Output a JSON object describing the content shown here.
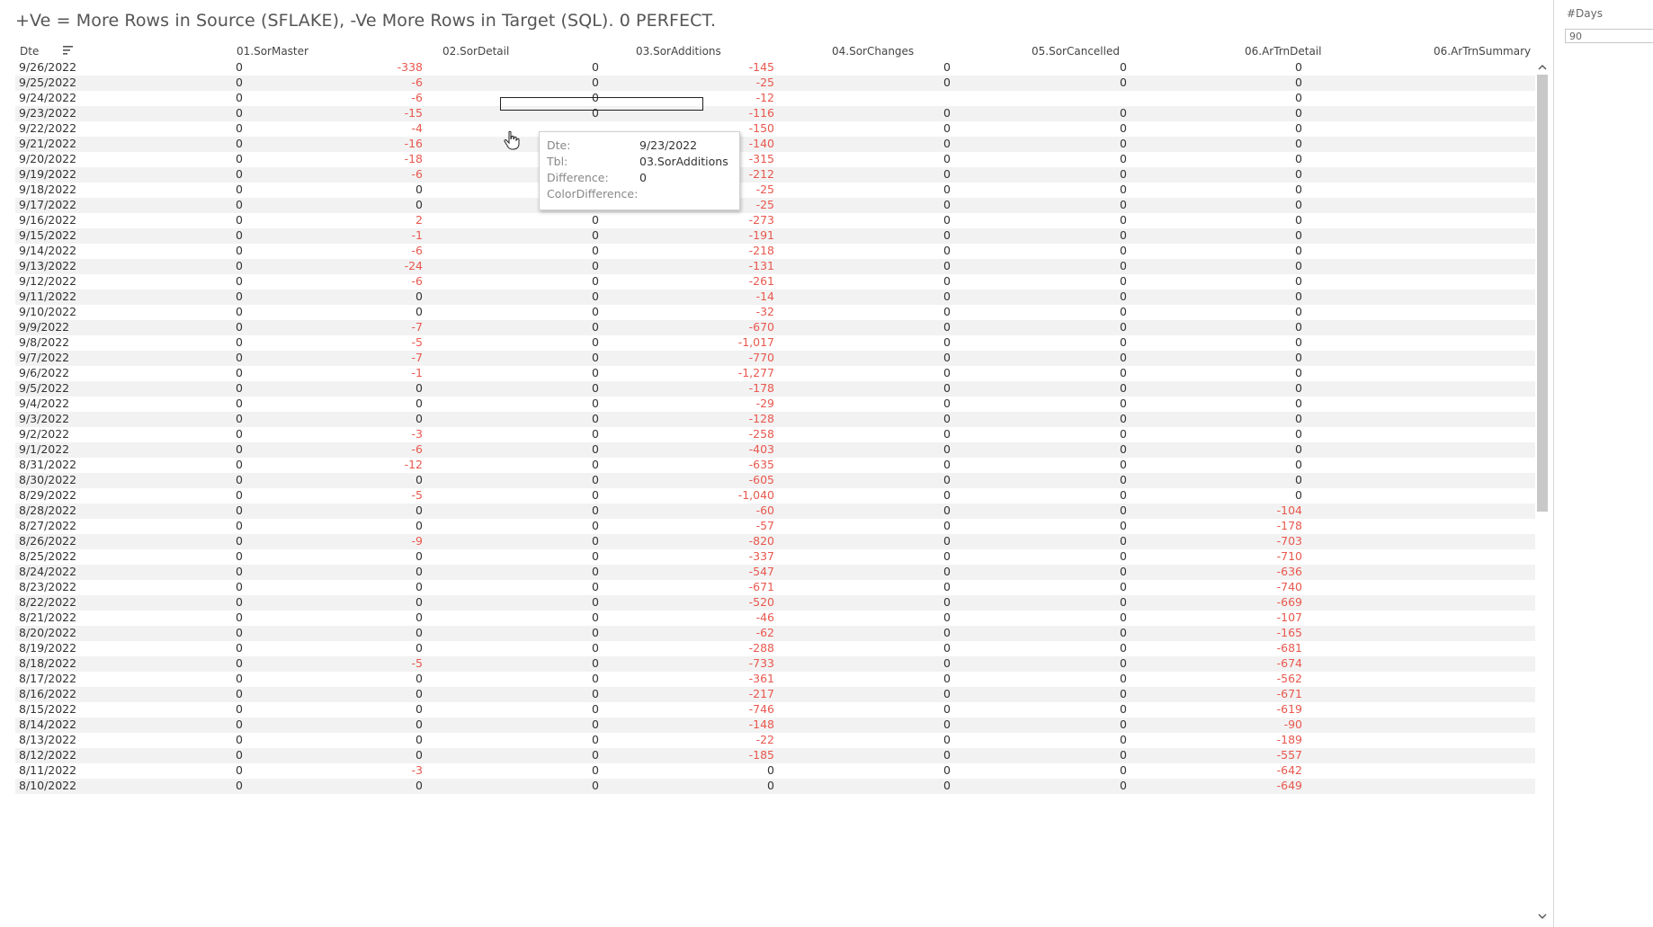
{
  "title": "+Ve  = More Rows in Source (SFLAKE), -Ve More Rows in Target (SQL). 0 PERFECT.",
  "param": {
    "label": "#Days",
    "value": "90"
  },
  "headers": [
    "Dte",
    "01.SorMaster",
    "02.SorDetail",
    "03.SorAdditions",
    "04.SorChanges",
    "05.SorCancelled",
    "06.ArTrnDetail",
    "06.ArTrnSummary"
  ],
  "rows": [
    [
      "9/26/2022",
      "0",
      "-338",
      "0",
      "-145",
      "0",
      "0",
      "0"
    ],
    [
      "9/25/2022",
      "0",
      "-6",
      "0",
      "-25",
      "0",
      "0",
      "0"
    ],
    [
      "9/24/2022",
      "0",
      "-6",
      "0",
      "-12",
      "",
      "",
      "0"
    ],
    [
      "9/23/2022",
      "0",
      "-15",
      "0",
      "-116",
      "0",
      "0",
      "0"
    ],
    [
      "9/22/2022",
      "0",
      "-4",
      "",
      "-150",
      "0",
      "0",
      "0"
    ],
    [
      "9/21/2022",
      "0",
      "-16",
      "",
      "-140",
      "0",
      "0",
      "0"
    ],
    [
      "9/20/2022",
      "0",
      "-18",
      "",
      "-315",
      "0",
      "0",
      "0"
    ],
    [
      "9/19/2022",
      "0",
      "-6",
      "",
      "-212",
      "0",
      "0",
      "0"
    ],
    [
      "9/18/2022",
      "0",
      "0",
      "0",
      "-25",
      "0",
      "0",
      "0"
    ],
    [
      "9/17/2022",
      "0",
      "0",
      "0",
      "-25",
      "0",
      "0",
      "0"
    ],
    [
      "9/16/2022",
      "0",
      "2",
      "0",
      "-273",
      "0",
      "0",
      "0"
    ],
    [
      "9/15/2022",
      "0",
      "-1",
      "0",
      "-191",
      "0",
      "0",
      "0"
    ],
    [
      "9/14/2022",
      "0",
      "-6",
      "0",
      "-218",
      "0",
      "0",
      "0"
    ],
    [
      "9/13/2022",
      "0",
      "-24",
      "0",
      "-131",
      "0",
      "0",
      "0"
    ],
    [
      "9/12/2022",
      "0",
      "-6",
      "0",
      "-261",
      "0",
      "0",
      "0"
    ],
    [
      "9/11/2022",
      "0",
      "0",
      "0",
      "-14",
      "0",
      "0",
      "0"
    ],
    [
      "9/10/2022",
      "0",
      "0",
      "0",
      "-32",
      "0",
      "0",
      "0"
    ],
    [
      "9/9/2022",
      "0",
      "-7",
      "0",
      "-670",
      "0",
      "0",
      "0"
    ],
    [
      "9/8/2022",
      "0",
      "-5",
      "0",
      "-1,017",
      "0",
      "0",
      "0"
    ],
    [
      "9/7/2022",
      "0",
      "-7",
      "0",
      "-770",
      "0",
      "0",
      "0"
    ],
    [
      "9/6/2022",
      "0",
      "-1",
      "0",
      "-1,277",
      "0",
      "0",
      "0"
    ],
    [
      "9/5/2022",
      "0",
      "0",
      "0",
      "-178",
      "0",
      "0",
      "0"
    ],
    [
      "9/4/2022",
      "0",
      "0",
      "0",
      "-29",
      "0",
      "0",
      "0"
    ],
    [
      "9/3/2022",
      "0",
      "0",
      "0",
      "-128",
      "0",
      "0",
      "0"
    ],
    [
      "9/2/2022",
      "0",
      "-3",
      "0",
      "-258",
      "0",
      "0",
      "0"
    ],
    [
      "9/1/2022",
      "0",
      "-6",
      "0",
      "-403",
      "0",
      "0",
      "0"
    ],
    [
      "8/31/2022",
      "0",
      "-12",
      "0",
      "-635",
      "0",
      "0",
      "0"
    ],
    [
      "8/30/2022",
      "0",
      "0",
      "0",
      "-605",
      "0",
      "0",
      "0"
    ],
    [
      "8/29/2022",
      "0",
      "-5",
      "0",
      "-1,040",
      "0",
      "0",
      "0"
    ],
    [
      "8/28/2022",
      "0",
      "0",
      "0",
      "-60",
      "0",
      "0",
      "-104"
    ],
    [
      "8/27/2022",
      "0",
      "0",
      "0",
      "-57",
      "0",
      "0",
      "-178"
    ],
    [
      "8/26/2022",
      "0",
      "-9",
      "0",
      "-820",
      "0",
      "0",
      "-703"
    ],
    [
      "8/25/2022",
      "0",
      "0",
      "0",
      "-337",
      "0",
      "0",
      "-710"
    ],
    [
      "8/24/2022",
      "0",
      "0",
      "0",
      "-547",
      "0",
      "0",
      "-636"
    ],
    [
      "8/23/2022",
      "0",
      "0",
      "0",
      "-671",
      "0",
      "0",
      "-740"
    ],
    [
      "8/22/2022",
      "0",
      "0",
      "0",
      "-520",
      "0",
      "0",
      "-669"
    ],
    [
      "8/21/2022",
      "0",
      "0",
      "0",
      "-46",
      "0",
      "0",
      "-107"
    ],
    [
      "8/20/2022",
      "0",
      "0",
      "0",
      "-62",
      "0",
      "0",
      "-165"
    ],
    [
      "8/19/2022",
      "0",
      "0",
      "0",
      "-288",
      "0",
      "0",
      "-681"
    ],
    [
      "8/18/2022",
      "0",
      "-5",
      "0",
      "-733",
      "0",
      "0",
      "-674"
    ],
    [
      "8/17/2022",
      "0",
      "0",
      "0",
      "-361",
      "0",
      "0",
      "-562"
    ],
    [
      "8/16/2022",
      "0",
      "0",
      "0",
      "-217",
      "0",
      "0",
      "-671"
    ],
    [
      "8/15/2022",
      "0",
      "0",
      "0",
      "-746",
      "0",
      "0",
      "-619"
    ],
    [
      "8/14/2022",
      "0",
      "0",
      "0",
      "-148",
      "0",
      "0",
      "-90"
    ],
    [
      "8/13/2022",
      "0",
      "0",
      "0",
      "-22",
      "0",
      "0",
      "-189"
    ],
    [
      "8/12/2022",
      "0",
      "0",
      "0",
      "-185",
      "0",
      "0",
      "-557"
    ],
    [
      "8/11/2022",
      "0",
      "-3",
      "0",
      "0",
      "0",
      "0",
      "-642"
    ],
    [
      "8/10/2022",
      "0",
      "0",
      "0",
      "0",
      "0",
      "0",
      "-649"
    ]
  ],
  "tooltip": {
    "rows": [
      {
        "label": "Dte:",
        "value": "9/23/2022"
      },
      {
        "label": "Tbl:",
        "value": "03.SorAdditions"
      },
      {
        "label": "Difference:",
        "value": "0"
      },
      {
        "label": "ColorDifference:",
        "value": ""
      }
    ]
  },
  "colors": {
    "negative": "#e8584e",
    "text": "#333333",
    "alt_row": "#f2f2f2"
  }
}
